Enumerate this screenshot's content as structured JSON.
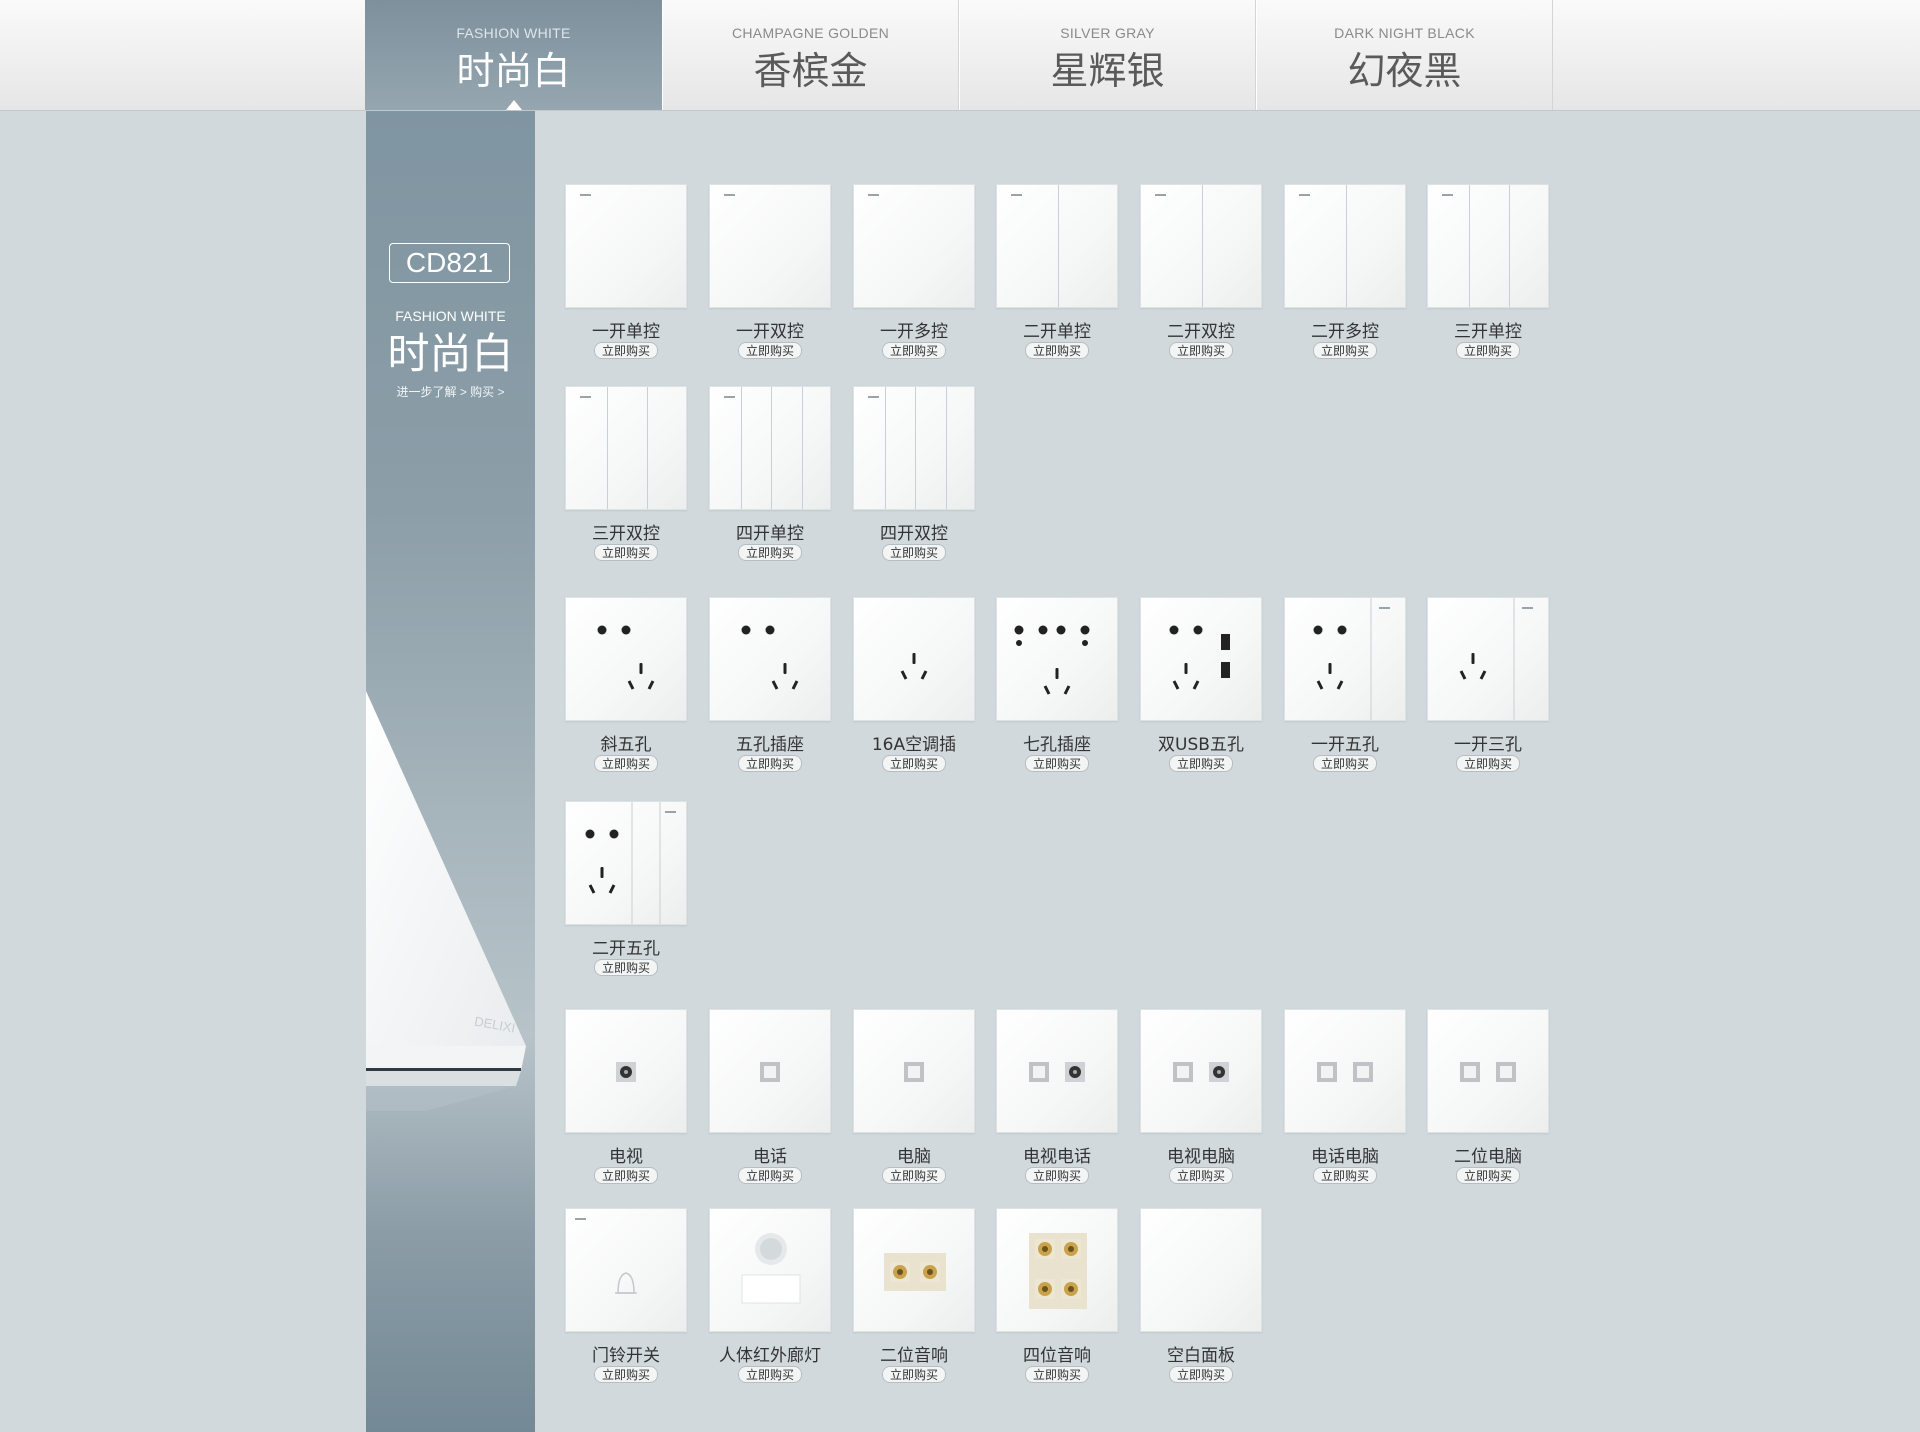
{
  "tabs": [
    {
      "en": "FASHION WHITE",
      "zh": "时尚白"
    },
    {
      "en": "CHAMPAGNE GOLDEN",
      "zh": "香槟金"
    },
    {
      "en": "SILVER GRAY",
      "zh": "星辉银"
    },
    {
      "en": "DARK NIGHT BLACK",
      "zh": "幻夜黑"
    }
  ],
  "sidebar": {
    "model": "CD821",
    "en": "FASHION WHITE",
    "zh": "时尚白",
    "learn_more": "进一步了解 >",
    "buy": "购买 >",
    "logo_text": "DELIXI"
  },
  "buy_label": "立即购买",
  "products": [
    {
      "name": "一开单控",
      "icon": "switch-1-gang-icon"
    },
    {
      "name": "一开双控",
      "icon": "switch-1-gang-icon"
    },
    {
      "name": "一开多控",
      "icon": "switch-1-gang-icon"
    },
    {
      "name": "二开单控",
      "icon": "switch-2-gang-icon"
    },
    {
      "name": "二开双控",
      "icon": "switch-2-gang-icon"
    },
    {
      "name": "二开多控",
      "icon": "switch-2-gang-icon"
    },
    {
      "name": "三开单控",
      "icon": "switch-3-gang-icon"
    },
    {
      "name": "三开双控",
      "icon": "switch-3-gang-icon"
    },
    {
      "name": "四开单控",
      "icon": "switch-4-gang-icon"
    },
    {
      "name": "四开双控",
      "icon": "switch-4-gang-icon"
    },
    {
      "name": "斜五孔",
      "icon": "socket-5-hole-icon"
    },
    {
      "name": "五孔插座",
      "icon": "socket-5-hole-icon"
    },
    {
      "name": "16A空调插",
      "icon": "socket-3-hole-icon"
    },
    {
      "name": "七孔插座",
      "icon": "socket-7-hole-icon"
    },
    {
      "name": "双USB五孔",
      "icon": "socket-usb-icon"
    },
    {
      "name": "一开五孔",
      "icon": "socket-switch-5-hole-icon"
    },
    {
      "name": "一开三孔",
      "icon": "socket-switch-3-hole-icon"
    },
    {
      "name": "二开五孔",
      "icon": "socket-switch2-5-hole-icon"
    },
    {
      "name": "电视",
      "icon": "tv-port-icon"
    },
    {
      "name": "电话",
      "icon": "phone-port-icon"
    },
    {
      "name": "电脑",
      "icon": "network-port-icon"
    },
    {
      "name": "电视电话",
      "icon": "tv-phone-port-icon"
    },
    {
      "name": "电视电脑",
      "icon": "tv-network-port-icon"
    },
    {
      "name": "电话电脑",
      "icon": "phone-network-port-icon"
    },
    {
      "name": "二位电脑",
      "icon": "dual-network-port-icon"
    },
    {
      "name": "门铃开关",
      "icon": "doorbell-icon"
    },
    {
      "name": "人体红外廊灯",
      "icon": "pir-sensor-icon"
    },
    {
      "name": "二位音响",
      "icon": "speaker-2-icon"
    },
    {
      "name": "四位音响",
      "icon": "speaker-4-icon"
    },
    {
      "name": "空白面板",
      "icon": "blank-panel-icon"
    }
  ]
}
